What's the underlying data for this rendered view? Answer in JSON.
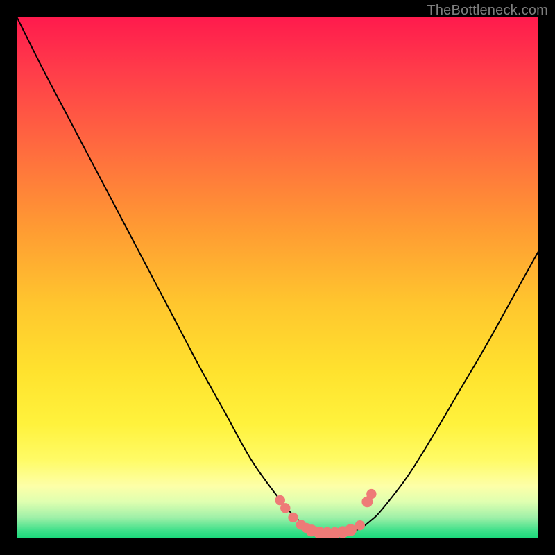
{
  "watermark": "TheBottleneck.com",
  "colors": {
    "curve": "#000000",
    "marker_fill": "#ee7a77",
    "marker_stroke": "#c9504f",
    "gradient_top": "#ff1a4d",
    "gradient_bottom": "#19d87a",
    "frame": "#000000"
  },
  "chart_data": {
    "type": "line",
    "title": "",
    "xlabel": "",
    "ylabel": "",
    "x_range": [
      0,
      100
    ],
    "y_range": [
      0,
      100
    ],
    "grid": false,
    "legend": false,
    "series": [
      {
        "name": "bottleneck-curve",
        "x": [
          0,
          5,
          10,
          15,
          20,
          25,
          30,
          35,
          40,
          45,
          50,
          52,
          54,
          56,
          58,
          60,
          62,
          64,
          66,
          68,
          70,
          75,
          80,
          85,
          90,
          95,
          100
        ],
        "values": [
          100,
          90,
          80.5,
          71,
          61.5,
          52,
          42.5,
          33,
          24,
          15,
          8,
          5.5,
          3.5,
          2,
          1.2,
          1,
          1,
          1.2,
          2,
          3.5,
          5.5,
          12,
          20,
          28.5,
          37,
          46,
          55
        ]
      }
    ],
    "markers": [
      {
        "x": 50.5,
        "y": 7.3,
        "r": 1.0
      },
      {
        "x": 51.5,
        "y": 5.8,
        "r": 1.0
      },
      {
        "x": 53.0,
        "y": 4.0,
        "r": 1.0
      },
      {
        "x": 54.5,
        "y": 2.6,
        "r": 1.0
      },
      {
        "x": 55.5,
        "y": 2.0,
        "r": 1.0
      },
      {
        "x": 56.5,
        "y": 1.5,
        "r": 1.2
      },
      {
        "x": 58.0,
        "y": 1.1,
        "r": 1.2
      },
      {
        "x": 59.5,
        "y": 1.0,
        "r": 1.2
      },
      {
        "x": 61.0,
        "y": 1.0,
        "r": 1.2
      },
      {
        "x": 62.5,
        "y": 1.2,
        "r": 1.2
      },
      {
        "x": 64.0,
        "y": 1.6,
        "r": 1.2
      },
      {
        "x": 65.8,
        "y": 2.5,
        "r": 1.0
      },
      {
        "x": 67.2,
        "y": 7.0,
        "r": 1.1
      },
      {
        "x": 68.0,
        "y": 8.5,
        "r": 1.0
      }
    ]
  }
}
